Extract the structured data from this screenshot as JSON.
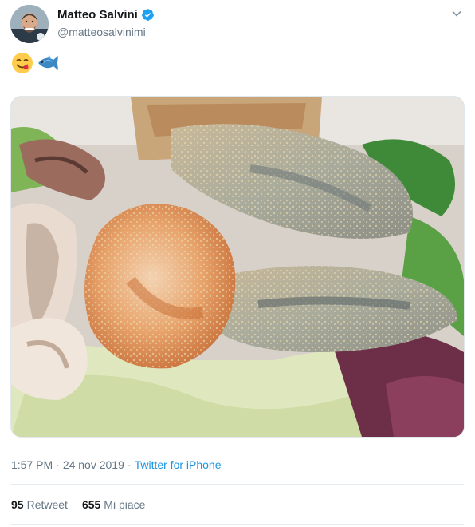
{
  "user": {
    "display_name": "Matteo Salvini",
    "handle": "@matteosalvinimi",
    "verified": true,
    "avatar_icon": "profile-photo"
  },
  "tweet": {
    "emojis": [
      "smiling-face-savoring-food-emoji",
      "fish-emoji"
    ],
    "media_description_icon": "food-photo"
  },
  "meta": {
    "time": "1:57 PM",
    "separator1": "·",
    "date": "24 nov 2019",
    "separator2": "·",
    "source": "Twitter for iPhone"
  },
  "stats": {
    "retweets_count": "95",
    "retweets_label": "Retweet",
    "likes_count": "655",
    "likes_label": "Mi piace"
  },
  "colors": {
    "link": "#1b95e0",
    "muted": "#657786",
    "verified": "#1da1f2"
  }
}
